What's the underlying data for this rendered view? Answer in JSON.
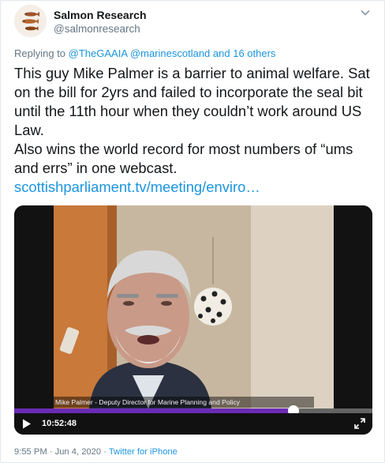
{
  "account": {
    "name": "Salmon Research",
    "handle": "@salmonresearch",
    "avatar_icon": "salmon-avatar-icon",
    "menu_icon": "chevron-down-icon"
  },
  "reply": {
    "prefix": "Replying to",
    "mention1": "@TheGAAIA",
    "mention2": "@marinescotland",
    "suffix": "and 16 others"
  },
  "tweet": {
    "text": "This guy Mike Palmer is a barrier to animal welfare. Sat on the bill for 2yrs and failed to incorporate the seal bit until the 11th hour when they couldn’t work around US Law.",
    "text2": "Also wins the world record for most numbers of “ums and errs” in one webcast.",
    "link": "scottishparliament.tv/meeting/enviro…"
  },
  "video": {
    "caption": "Mike Palmer - Deputy Director for Marine Planning and Policy",
    "time": "10:52:48",
    "progress": 0.78,
    "accent": "#6a2bb5",
    "play_icon": "play-icon",
    "fullscreen_icon": "fullscreen-icon"
  },
  "meta": {
    "timestamp": "9:55 PM · Jun 4, 2020",
    "separator": "·",
    "source": "Twitter for iPhone"
  },
  "colors": {
    "text": "#14171a",
    "secondary": "#657786",
    "link": "#1b95e0"
  }
}
